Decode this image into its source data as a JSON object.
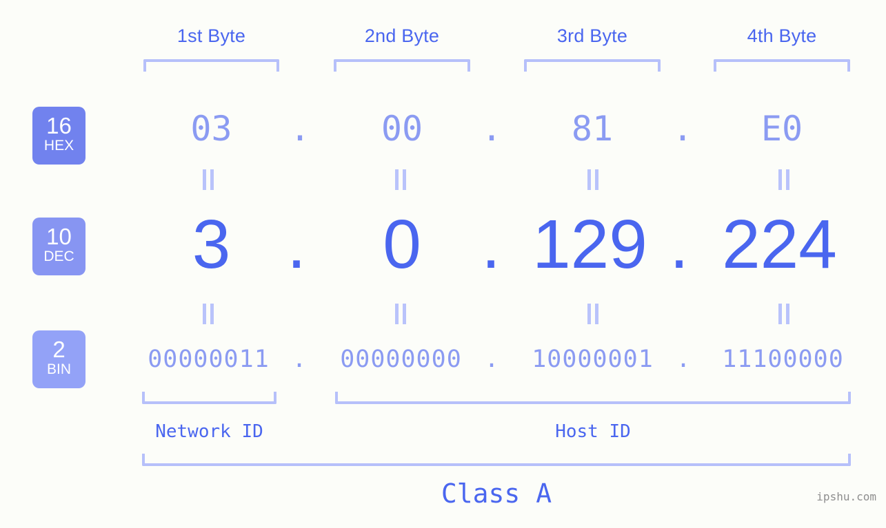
{
  "ip": {
    "dotted_decimal": "3.0.129.224",
    "class": "Class A"
  },
  "byte_headers": [
    {
      "label": "1st Byte"
    },
    {
      "label": "2nd Byte"
    },
    {
      "label": "3rd Byte"
    },
    {
      "label": "4th Byte"
    }
  ],
  "bases": [
    {
      "num": "16",
      "label": "HEX",
      "color": "#7182ee"
    },
    {
      "num": "10",
      "label": "DEC",
      "color": "#8795f2"
    },
    {
      "num": "2",
      "label": "BIN",
      "color": "#93a2f7"
    }
  ],
  "rows": {
    "hex": {
      "values": [
        "03",
        "00",
        "81",
        "E0"
      ],
      "separator": "."
    },
    "dec": {
      "values": [
        "3",
        "0",
        "129",
        "224"
      ],
      "separator": "."
    },
    "bin": {
      "values": [
        "00000011",
        "00000000",
        "10000001",
        "11100000"
      ],
      "separator": "."
    }
  },
  "segments": [
    {
      "label": "Network ID"
    },
    {
      "label": "Host ID"
    }
  ],
  "class_label": "Class A",
  "watermark": "ipshu.com",
  "colors": {
    "background": "#fcfdf9",
    "accent_strong": "#4a66ef",
    "accent_light": "#8b9bf2",
    "bracket": "#b6c0fa",
    "eqbar": "#b9c3fb",
    "watermark": "#8e8e8e"
  }
}
